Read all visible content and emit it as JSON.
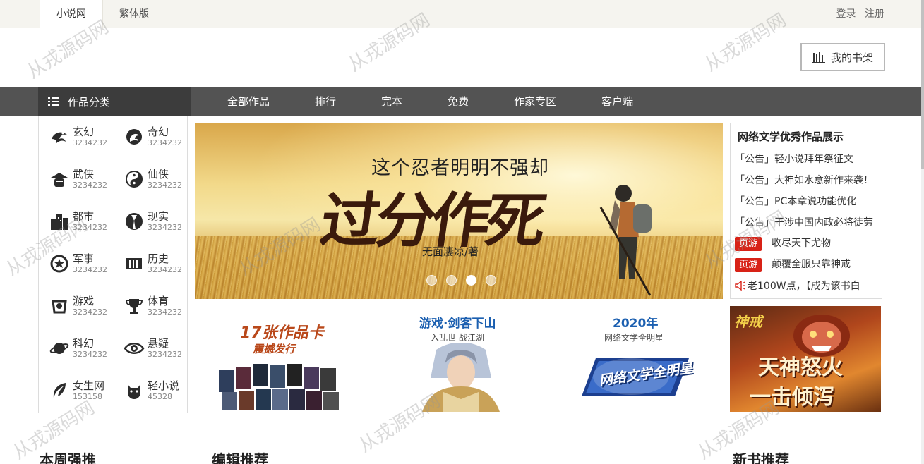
{
  "topbar": {
    "tabs": [
      {
        "label": "小说网"
      },
      {
        "label": "繁体版"
      }
    ],
    "login": "登录",
    "register": "注册"
  },
  "header": {
    "shelf_label": "我的书架"
  },
  "nav": {
    "category_label": "作品分类",
    "items": [
      {
        "label": "全部作品"
      },
      {
        "label": "排行"
      },
      {
        "label": "完本"
      },
      {
        "label": "免费"
      },
      {
        "label": "作家专区"
      },
      {
        "label": "客户端"
      }
    ]
  },
  "categories": [
    {
      "name": "玄幻",
      "count": "3234232",
      "icon": "dragon-icon"
    },
    {
      "name": "奇幻",
      "count": "3234232",
      "icon": "phoenix-icon"
    },
    {
      "name": "武侠",
      "count": "3234232",
      "icon": "swordsman-hat-icon"
    },
    {
      "name": "仙侠",
      "count": "3234232",
      "icon": "yin-yang-icon"
    },
    {
      "name": "都市",
      "count": "3234232",
      "icon": "city-icon"
    },
    {
      "name": "现实",
      "count": "3234232",
      "icon": "suit-icon"
    },
    {
      "name": "军事",
      "count": "3234232",
      "icon": "military-badge-icon"
    },
    {
      "name": "历史",
      "count": "3234232",
      "icon": "scroll-icon"
    },
    {
      "name": "游戏",
      "count": "3234232",
      "icon": "gamepad-icon"
    },
    {
      "name": "体育",
      "count": "3234232",
      "icon": "trophy-icon"
    },
    {
      "name": "科幻",
      "count": "3234232",
      "icon": "planet-icon"
    },
    {
      "name": "悬疑",
      "count": "3234232",
      "icon": "eye-icon"
    },
    {
      "name": "女生网",
      "count": "153158",
      "icon": "feather-icon"
    },
    {
      "name": "轻小说",
      "count": "45328",
      "icon": "cat-icon"
    }
  ],
  "banner": {
    "subtitle": "这个忍者明明不强却",
    "title": "过分作死",
    "author": "无面凄凉/著",
    "slide_count": 4,
    "active_slide": 3
  },
  "news": {
    "title": "网络文学优秀作品展示",
    "notices": [
      {
        "text": "「公告」轻小说拜年祭征文"
      },
      {
        "text": "「公告」大神如水意新作来袭！"
      },
      {
        "text": "「公告」PC本章说功能优化"
      },
      {
        "text": "「公告」干涉中国内政必将徒劳"
      }
    ],
    "games": [
      {
        "tag": "页游",
        "text": "收尽天下尤物"
      },
      {
        "tag": "页游",
        "text": "颠覆全服只靠神戒"
      }
    ],
    "ticker": "老100W点，【成为该书白"
  },
  "promos": {
    "p1": {
      "title": "17张作品卡",
      "subtitle": "震撼发行"
    },
    "p2": {
      "title": "游戏·剑客下山",
      "subtitle": "入乱世  战江湖"
    },
    "p3": {
      "title": "2020年",
      "subtitle": "网络文学全明星",
      "badge_text": "网络文学全明星"
    },
    "p4": {
      "logo": "神戒",
      "line1": "天神怒火",
      "line2": "一击倾泻"
    }
  },
  "sections": [
    {
      "title": "本周强推"
    },
    {
      "title": "编辑推荐"
    },
    {
      "title": "新书推荐"
    }
  ],
  "watermark": "从戎源码网"
}
